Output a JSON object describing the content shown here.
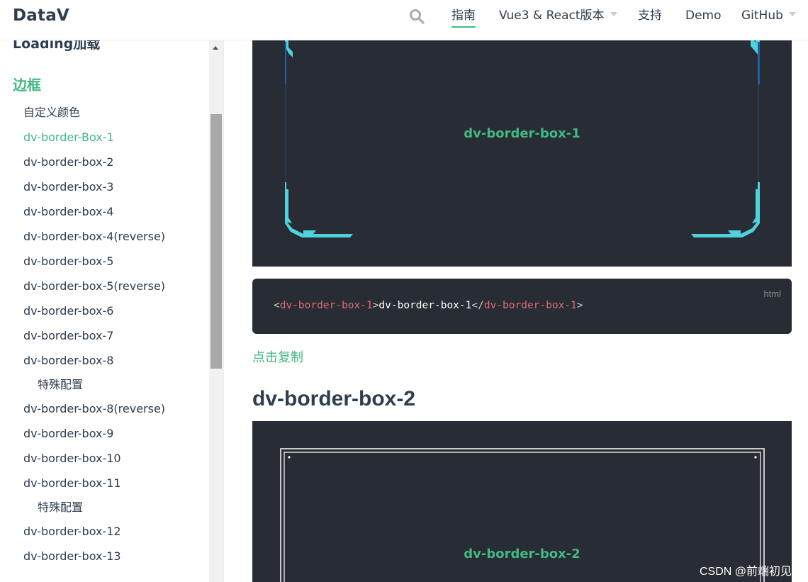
{
  "header": {
    "logo": "DataV",
    "nav": [
      {
        "label": "指南",
        "active": true
      },
      {
        "label": "Vue3 & React版本",
        "dropdown": true
      },
      {
        "label": "支持"
      },
      {
        "label": "Demo"
      },
      {
        "label": "GitHub",
        "dropdown": true
      }
    ]
  },
  "sidebar": {
    "cut_title": "Loading加载",
    "heading": "边框",
    "items": [
      {
        "label": "自定义颜色"
      },
      {
        "label": "dv-border-Box-1",
        "active": true
      },
      {
        "label": "dv-border-box-2"
      },
      {
        "label": "dv-border-box-3"
      },
      {
        "label": "dv-border-box-4"
      },
      {
        "label": "dv-border-box-4(reverse)"
      },
      {
        "label": "dv-border-box-5"
      },
      {
        "label": "dv-border-box-5(reverse)"
      },
      {
        "label": "dv-border-box-6"
      },
      {
        "label": "dv-border-box-7"
      },
      {
        "label": "dv-border-box-8"
      },
      {
        "label": "特殊配置",
        "sub": true
      },
      {
        "label": "dv-border-box-8(reverse)"
      },
      {
        "label": "dv-border-box-9"
      },
      {
        "label": "dv-border-box-10"
      },
      {
        "label": "dv-border-box-11"
      },
      {
        "label": "特殊配置",
        "sub": true
      },
      {
        "label": "dv-border-box-12"
      },
      {
        "label": "dv-border-box-13"
      }
    ]
  },
  "main": {
    "demo1_text": "dv-border-box-1",
    "code": {
      "lang": "html",
      "open_lt": "<",
      "open_tag": "dv-border-box-1",
      "open_gt": ">",
      "content": "dv-border-box-1",
      "close_lt": "</",
      "close_tag": "dv-border-box-1",
      "close_gt": ">"
    },
    "copy_label": "点击复制",
    "section2_title": "dv-border-box-2",
    "demo2_text": "dv-border-box-2"
  },
  "watermark": "CSDN @前端初见",
  "colors": {
    "accent": "#42b983",
    "text": "#2c3e50",
    "dark_bg": "#282c34",
    "border_box1": "#4fd2dd",
    "border_box1_alt": "#235fa7",
    "code_tag": "#e06c75"
  }
}
